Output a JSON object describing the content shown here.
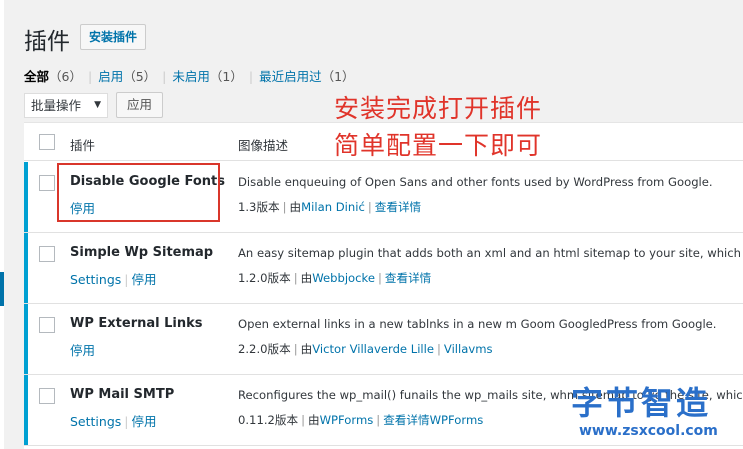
{
  "header": {
    "title": "插件",
    "add_button": "安装插件"
  },
  "filters": [
    {
      "label": "全部",
      "count": "（6）",
      "current": true
    },
    {
      "label": "启用",
      "count": "（5）",
      "current": false
    },
    {
      "label": "未启用",
      "count": "（1）",
      "current": false
    },
    {
      "label": "最近启用过",
      "count": "（1）",
      "current": false
    }
  ],
  "bulk": {
    "select_value": "批量操作",
    "apply_label": "应用"
  },
  "overlay": {
    "line1": "安装完成打开插件",
    "line2": "简单配置一下即可"
  },
  "table": {
    "col_name": "插件",
    "col_desc": "图像描述",
    "rows": [
      {
        "name": "Disable Google Fonts",
        "actions": [
          "停用"
        ],
        "description": "Disable enqueuing of Open Sans and other fonts used by WordPress from Google.",
        "version": "1.3版本",
        "by": "由",
        "author": "Milan Dinić",
        "details": "查看详情"
      },
      {
        "name": "Simple Wp Sitemap",
        "actions": [
          "Settings",
          "停用"
        ],
        "description": "An easy sitemap plugin that adds both an xml and an html sitemap to your site, which up",
        "version": "1.2.0版本",
        "by": "由",
        "author": "Webbjocke",
        "details": "查看详情"
      },
      {
        "name": "WP External Links",
        "actions": [
          "停用"
        ],
        "description": "Open external links in a new tablnks in a new     m Goom GoogledPress from Google.",
        "version": "2.2.0版本",
        "by": "由",
        "author": "Victor Villaverde Lille",
        "details": "Villavms"
      },
      {
        "name": "WP Mail SMTP",
        "actions": [
          "Settings",
          "停用"
        ],
        "description": "Reconfigures the wp_mail() funails the wp_mails     site, whm sitemap to yo the site, which u",
        "version": "0.11.2版本",
        "by": "由",
        "author": "WPForms",
        "details": "查看详情WPForms"
      }
    ]
  },
  "watermark": {
    "cn": "字节智造",
    "url": "www.zsxcool.com"
  },
  "colors": {
    "link": "#0073aa",
    "active_bar": "#00a0d2",
    "annotation": "#e0342a",
    "watermark": "#2a6fc9"
  }
}
